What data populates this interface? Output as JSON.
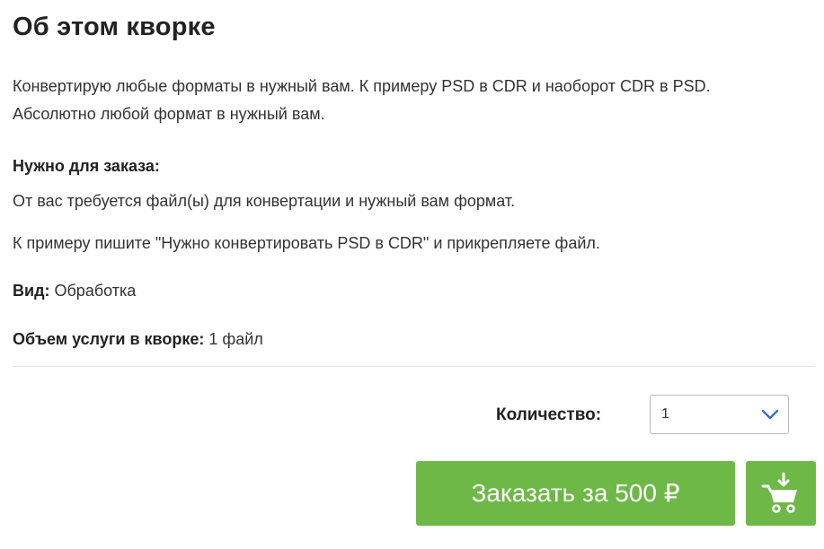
{
  "section": {
    "title": "Об этом кворке",
    "description": [
      "Конвертирую любые форматы в нужный вам. К примеру PSD в CDR и наоборот CDR в PSD.",
      "Абсолютно любой формат в нужный вам."
    ]
  },
  "requirements": {
    "title": "Нужно для заказа:",
    "lines": [
      "От вас требуется файл(ы) для конвертации и нужный вам формат.",
      "К примеру пишите \"Нужно конвертировать PSD в CDR\" и прикрепляете файл."
    ]
  },
  "properties": {
    "kind_label": "Вид:",
    "kind_value": "Обработка",
    "volume_label": "Объем услуги в кворке:",
    "volume_value": "1 файл"
  },
  "order": {
    "quantity_label": "Количество:",
    "quantity_value": "1",
    "button_label": "Заказать за 500 ₽",
    "cart_icon": "add-to-cart-icon"
  },
  "colors": {
    "accent_green": "#6eb847",
    "chevron_blue": "#3a6fc4"
  }
}
